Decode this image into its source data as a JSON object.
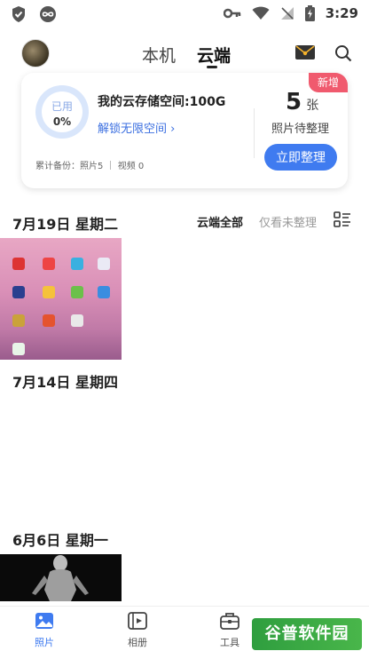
{
  "statusbar": {
    "time": "3:29"
  },
  "header": {
    "tab_local": "本机",
    "tab_cloud": "云端"
  },
  "storage_card": {
    "used_label": "已用",
    "used_percent": "0%",
    "title": "我的云存储空间:100G",
    "unlock_link": "解锁无限空间 ›",
    "badge_new": "新增",
    "pending_count": "5",
    "pending_unit": "张",
    "pending_label": "照片待整理",
    "organize_button": "立即整理",
    "backup_summary": "累计备份：照片5 ｜ 视频 0"
  },
  "filters": {
    "all": "云端全部",
    "unsorted": "仅看未整理"
  },
  "groups": [
    {
      "date": "7月19日 星期二"
    },
    {
      "date": "7月14日 星期四"
    },
    {
      "date": "6月6日 星期一"
    }
  ],
  "bottom_nav": [
    {
      "label": "照片",
      "active": true
    },
    {
      "label": "相册",
      "active": false
    },
    {
      "label": "工具",
      "active": false
    }
  ],
  "watermark": "谷普软件园",
  "colors": {
    "accent": "#3f7bf0",
    "badge": "#f05a6e"
  }
}
